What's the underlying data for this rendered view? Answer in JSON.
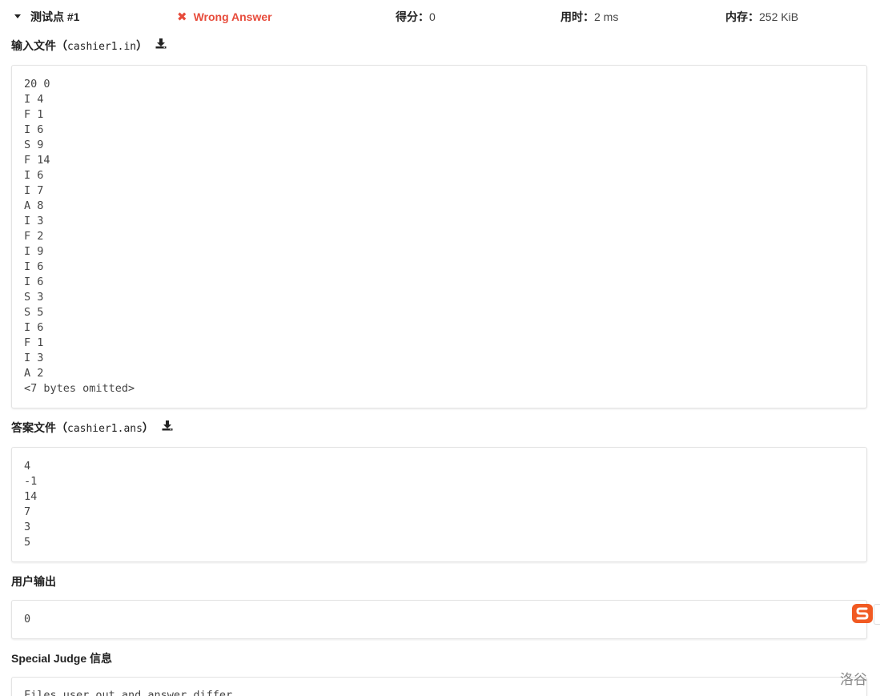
{
  "testcase": {
    "title": "测试点 #1",
    "status": "Wrong Answer",
    "score_label": "得分：",
    "score_value": "0",
    "time_label": "用时：",
    "time_value": "2 ms",
    "memory_label": "内存：",
    "memory_value": "252 KiB"
  },
  "input_section": {
    "label_prefix": "输入文件（",
    "filename": "cashier1.in",
    "label_suffix": "）",
    "content": "20 0\nI 4\nF 1\nI 6\nS 9\nF 14\nI 6\nI 7\nA 8\nI 3\nF 2\nI 9\nI 6\nI 6\nS 3\nS 5\nI 6\nF 1\nI 3\nA 2\n<7 bytes omitted>"
  },
  "answer_section": {
    "label_prefix": "答案文件（",
    "filename": "cashier1.ans",
    "label_suffix": "）",
    "content": "4\n-1\n14\n7\n3\n5"
  },
  "user_output_section": {
    "label": "用户输出",
    "content": "0"
  },
  "spj_section": {
    "label": "Special Judge 信息",
    "content": "Files user_out and answer differ"
  },
  "watermark": "洛谷",
  "colors": {
    "wrong_answer": "#e74c3c",
    "sogou_orange": "#f15a22"
  }
}
